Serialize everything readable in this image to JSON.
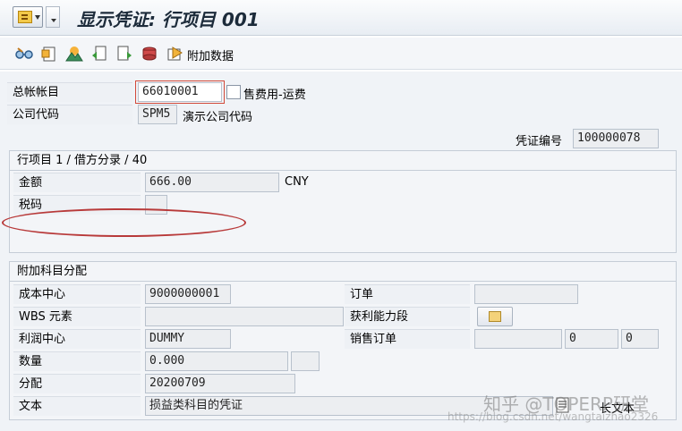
{
  "title": "显示凭证: 行项目 001",
  "toolbar": {
    "icons": [
      "glasses-icon",
      "document-up-icon",
      "mountain-icon",
      "document-back-icon",
      "document-forward-icon",
      "stack-icon",
      "additional-data-icon"
    ],
    "additional_data_label": "附加数据"
  },
  "header": {
    "gl_account_label": "总帐帐目",
    "gl_account_value": "66010001",
    "gl_account_desc": "售费用-运费",
    "company_code_label": "公司代码",
    "company_code_value": "SPM5",
    "company_code_desc": "演示公司代码",
    "doc_no_label": "凭证编号",
    "doc_no_value": "100000078"
  },
  "line_item": {
    "group_title": "行项目 1 / 借方分录 / 40",
    "amount_label": "金额",
    "amount_value": "666.00",
    "currency": "CNY",
    "tax_code_label": "税码",
    "tax_code_value": ""
  },
  "assignment": {
    "group_title": "附加科目分配",
    "cost_center_label": "成本中心",
    "cost_center_value": "9000000001",
    "order_label": "订单",
    "order_value": "",
    "wbs_label": "WBS 元素",
    "wbs_value": "",
    "profit_segment_label": "获利能力段",
    "profit_center_label": "利润中心",
    "profit_center_value": "DUMMY",
    "sales_order_label": "销售订单",
    "sales_order_value": "",
    "sales_order_item": "0",
    "sales_order_sched": "0",
    "quantity_label": "数量",
    "quantity_value": "0.000",
    "quantity_unit": "",
    "allocation_label": "分配",
    "allocation_value": "20200709",
    "text_label": "文本",
    "text_value": "损益类科目的凭证",
    "long_text_label": "长文本"
  },
  "watermark": {
    "main": "知乎 @TOPERP研堂",
    "url": "https://blog.csdn.net/wangtaizhao2326"
  }
}
